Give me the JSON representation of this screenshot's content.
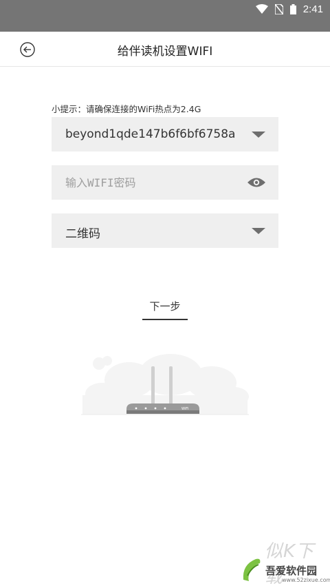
{
  "status_bar": {
    "time": "2:41"
  },
  "header": {
    "title": "给伴读机设置WIFI"
  },
  "form": {
    "hint": "小提示：请确保连接的WiFi热点为2.4G",
    "ssid_value": "beyond1qde147b6f6bf6758a",
    "password_placeholder": "输入WIFI密码",
    "mode_value": "二维码"
  },
  "actions": {
    "next_label": "下一步"
  },
  "illustration": {
    "router_label": "WiFi"
  },
  "watermark": {
    "big_text": "似K下载",
    "site_name": "吾爱软件园",
    "url": "www.52zixue.com"
  }
}
